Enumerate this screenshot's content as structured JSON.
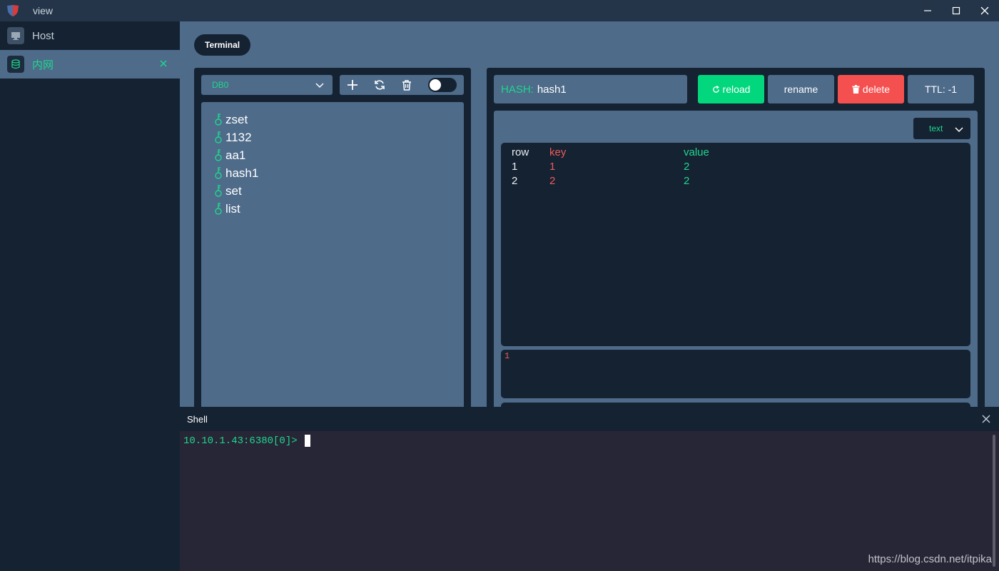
{
  "window": {
    "title": "view"
  },
  "sidebar": {
    "items": [
      {
        "label": "Host"
      },
      {
        "label": "内网"
      }
    ]
  },
  "main": {
    "tab_label": "Terminal",
    "db_select": {
      "value": "DB0"
    },
    "keys": [
      "zset",
      "1132",
      "aa1",
      "hash1",
      "set",
      "list"
    ],
    "detail": {
      "key_type": "HASH:",
      "key_name": "hash1",
      "reload_label": "reload",
      "rename_label": "rename",
      "delete_label": "delete",
      "ttl_label": "TTL: -1",
      "format_value": "text",
      "table": {
        "headers": {
          "row": "row",
          "key": "key",
          "value": "value"
        },
        "rows": [
          {
            "row": "1",
            "key": "1",
            "value": "2"
          },
          {
            "row": "2",
            "key": "2",
            "value": "2"
          }
        ]
      },
      "editor_value": "1"
    }
  },
  "shell": {
    "title": "Shell",
    "prompt": "10.10.1.43:6380[0]>"
  },
  "watermark": "https://blog.csdn.net/itpika",
  "colors": {
    "accent": "#1fd68e",
    "panel": "#4e6b8a",
    "dark": "#152232",
    "danger": "#f45050"
  }
}
